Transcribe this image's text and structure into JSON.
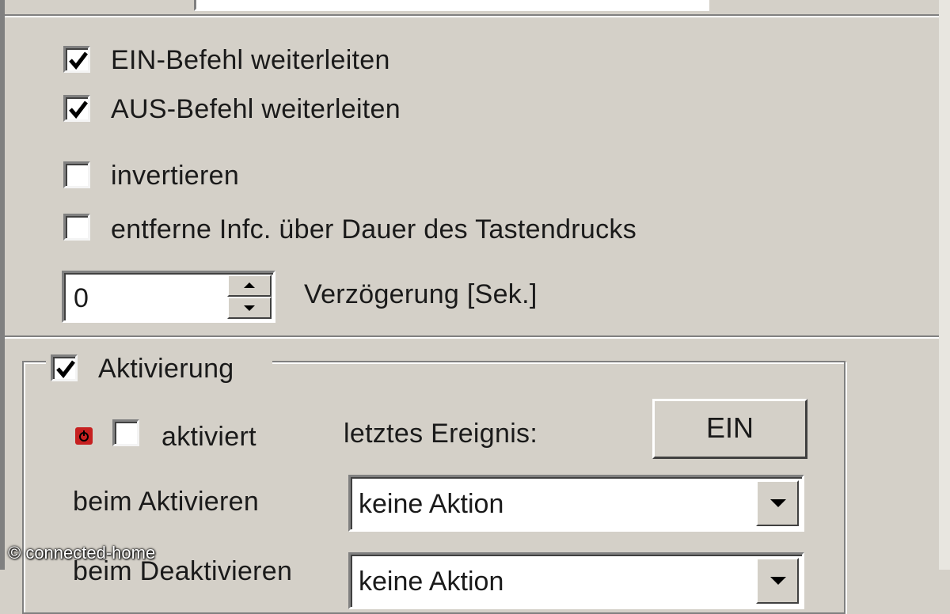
{
  "options": {
    "forward_on": {
      "label": "EIN-Befehl weiterleiten",
      "checked": true
    },
    "forward_off": {
      "label": "AUS-Befehl weiterleiten",
      "checked": true
    },
    "invert": {
      "label": "invertieren",
      "checked": false
    },
    "remove_duration": {
      "label": "entferne Infc. über Dauer des Tastendrucks",
      "checked": false
    }
  },
  "delay": {
    "value": "0",
    "label": "Verzögerung [Sek.]"
  },
  "activation": {
    "group_label": "Aktivierung",
    "group_checked": true,
    "activated_label": "aktiviert",
    "activated_checked": false,
    "last_event_label": "letztes Ereignis:",
    "last_event_value": "EIN",
    "on_activate_label": "beim Aktivieren",
    "on_activate_value": "keine Aktion",
    "on_deactivate_label": "beim Deaktivieren",
    "on_deactivate_value": "keine Aktion"
  },
  "watermark": "© connected-home",
  "colors": {
    "face": "#d4d0c8",
    "shadow": "#808080",
    "status_icon": "#c62020"
  },
  "icons": {
    "power": "power-icon",
    "check": "checkmark-icon"
  }
}
